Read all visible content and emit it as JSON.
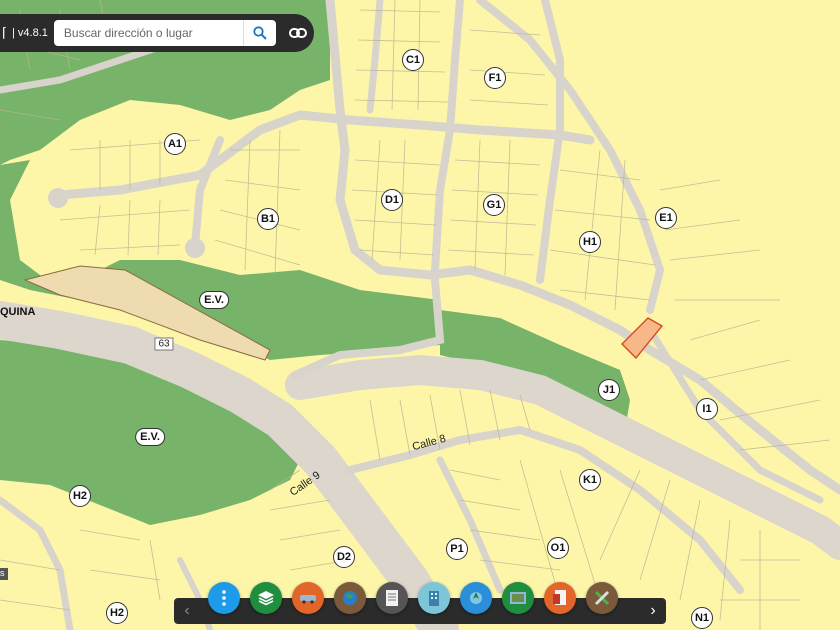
{
  "toolbar": {
    "version": "| v4.8.1",
    "search_placeholder": "Buscar dirección o lugar"
  },
  "map": {
    "block_labels": [
      "C1",
      "F1",
      "A1",
      "D1",
      "G1",
      "B1",
      "H1",
      "E1",
      "J1",
      "I1",
      "K1",
      "H2",
      "P1",
      "O1",
      "D2",
      "H2",
      "N1"
    ],
    "green_area_labels": [
      "E.V.",
      "E.V."
    ],
    "streets": [
      "Calle 8",
      "Calle 9"
    ],
    "road_number": "63",
    "road_name": "QUINA",
    "left_stub_text": "s"
  },
  "bottom_tools": [
    {
      "name": "menu",
      "icon": "more-vert-icon",
      "color": "#1e9be8"
    },
    {
      "name": "layers",
      "icon": "layers-icon",
      "color": "#1f8e3e"
    },
    {
      "name": "vehicle",
      "icon": "vehicle-icon",
      "color": "#e2662a"
    },
    {
      "name": "globe",
      "icon": "globe-icon",
      "color": "#7a5a3a"
    },
    {
      "name": "document",
      "icon": "document-icon",
      "color": "#555555"
    },
    {
      "name": "building",
      "icon": "building-icon",
      "color": "#7cc6d8"
    },
    {
      "name": "gps",
      "icon": "gps-icon",
      "color": "#2a8fd8"
    },
    {
      "name": "map-view",
      "icon": "map-view-icon",
      "color": "#1f8e3e"
    },
    {
      "name": "report",
      "icon": "report-icon",
      "color": "#e2662a"
    },
    {
      "name": "tools",
      "icon": "tools-icon",
      "color": "#7a5a3a"
    }
  ]
}
